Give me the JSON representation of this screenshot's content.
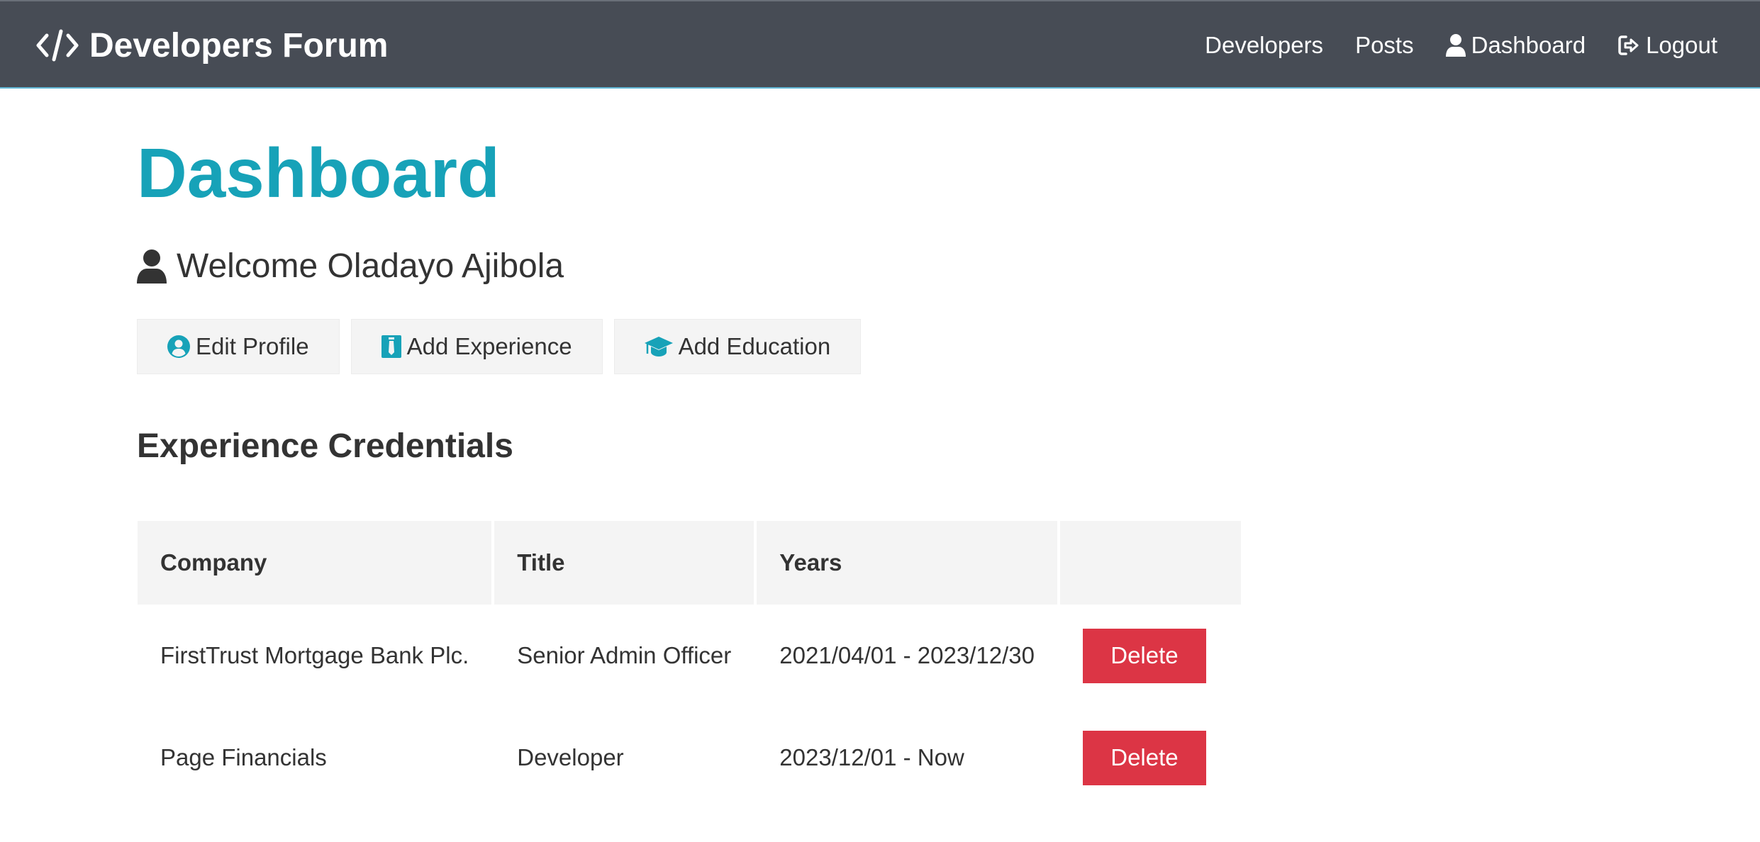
{
  "navbar": {
    "brand": "Developers Forum",
    "links": [
      {
        "label": "Developers"
      },
      {
        "label": "Posts"
      },
      {
        "label": "Dashboard"
      },
      {
        "label": "Logout"
      }
    ]
  },
  "page": {
    "title": "Dashboard",
    "welcome": "Welcome Oladayo Ajibola"
  },
  "actions": {
    "edit_profile": "Edit Profile",
    "add_experience": "Add Experience",
    "add_education": "Add Education"
  },
  "experience": {
    "section_title": "Experience Credentials",
    "headers": [
      "Company",
      "Title",
      "Years",
      ""
    ],
    "rows": [
      {
        "company": "FirstTrust Mortgage Bank Plc.",
        "title": "Senior Admin Officer",
        "years": "2021/04/01 - 2023/12/30",
        "action": "Delete"
      },
      {
        "company": "Page Financials",
        "title": "Developer",
        "years": "2023/12/01 - Now",
        "action": "Delete"
      }
    ]
  },
  "colors": {
    "navbar_bg": "#474c55",
    "primary": "#17a2b8",
    "danger": "#dc3545",
    "light": "#f4f4f4"
  },
  "icons": {
    "brand": "code-icon",
    "dashboard": "user-icon",
    "logout": "sign-out-icon",
    "welcome": "user-icon",
    "edit_profile": "user-circle-icon",
    "add_experience": "id-badge-icon",
    "add_education": "graduation-cap-icon"
  }
}
